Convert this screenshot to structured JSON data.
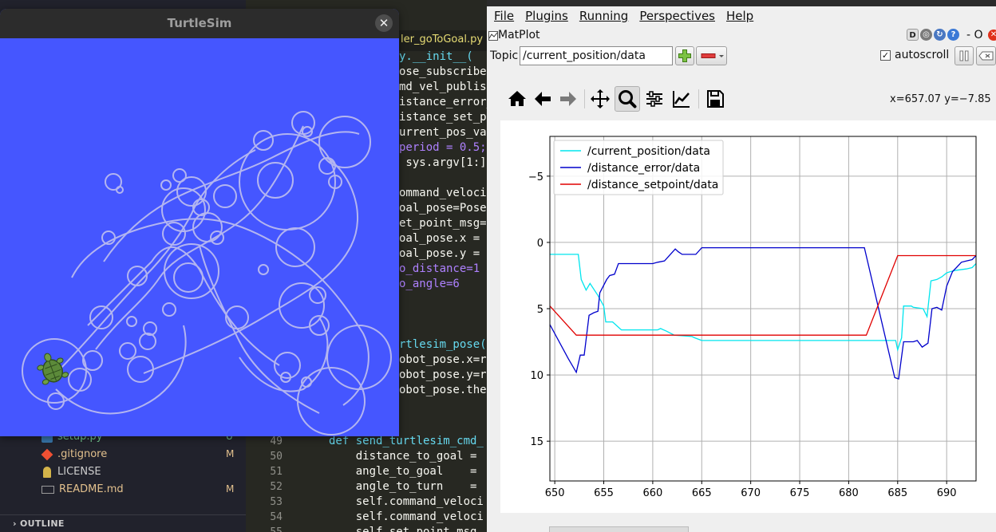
{
  "editor": {
    "tab_title": "ler_goToGoal.py",
    "code_lines": [
      {
        "t": "y.__init__(",
        "c": "fn"
      },
      {
        "t": "ose_subscribe",
        "c": ""
      },
      {
        "t": "md_vel_publis",
        "c": ""
      },
      {
        "t": "istance_error_",
        "c": ""
      },
      {
        "t": "istance_set_po",
        "c": ""
      },
      {
        "t": "urrent_pos_va",
        "c": ""
      },
      {
        "t": "period = 0.5;",
        "c": "num"
      },
      {
        "t": " sys.argv[1:]",
        "c": ""
      },
      {
        "t": "",
        "c": ""
      },
      {
        "t": "ommand_veloci",
        "c": ""
      },
      {
        "t": "oal_pose=Pose",
        "c": ""
      },
      {
        "t": "et_point_msg=",
        "c": ""
      },
      {
        "t": "oal_pose.x = ",
        "c": ""
      },
      {
        "t": "oal_pose.y = ",
        "c": ""
      },
      {
        "t": "o_distance=1",
        "c": "num"
      },
      {
        "t": "o_angle=6",
        "c": "num"
      },
      {
        "t": "",
        "c": ""
      },
      {
        "t": "",
        "c": ""
      },
      {
        "t": "",
        "c": ""
      },
      {
        "t": "rtlesim_pose(",
        "c": "fn"
      },
      {
        "t": "obot_pose.x=r",
        "c": ""
      },
      {
        "t": "obot_pose.y=r",
        "c": ""
      },
      {
        "t": "obot_pose.the",
        "c": ""
      }
    ],
    "lower_lines": [
      {
        "n": "49",
        "t": "def send_turtlesim_cmd_",
        "c": "kw"
      },
      {
        "n": "50",
        "t": "    distance_to_goal = ",
        "c": ""
      },
      {
        "n": "51",
        "t": "    angle_to_goal    = ",
        "c": ""
      },
      {
        "n": "52",
        "t": "    angle_to_turn    = ",
        "c": ""
      },
      {
        "n": "53",
        "t": "    self.command_veloci",
        "c": ""
      },
      {
        "n": "54",
        "t": "    self.command_veloci",
        "c": ""
      },
      {
        "n": "55",
        "t": "    self.set_point_msg.",
        "c": ""
      }
    ],
    "files": [
      {
        "name": "setup.py",
        "badge": "U"
      },
      {
        "name": ".gitignore",
        "badge": "M"
      },
      {
        "name": "LICENSE",
        "badge": ""
      },
      {
        "name": "README.md",
        "badge": "M"
      }
    ],
    "outline_label": "OUTLINE"
  },
  "turtlesim": {
    "title": "TurtleSim",
    "close_label": "✕",
    "background": "#4556ff",
    "trail_color": "#b3b5f0"
  },
  "rqt": {
    "menu": [
      "File",
      "Plugins",
      "Running",
      "Perspectives",
      "Help"
    ],
    "plugin_title": "MatPlot",
    "dock_d": "D",
    "dock_dash_o": "- O",
    "topic_label": "Topic",
    "topic_value": "/current_position/data",
    "autoscroll_label": "autoscroll",
    "autoscroll_checked": "✓",
    "coords_readout": "x=657.07 y=−7.85",
    "toolbar": [
      "home-icon",
      "back-icon",
      "forward-icon",
      "pan-icon",
      "zoom-icon",
      "configure-icon",
      "edit-curves-icon",
      "save-icon"
    ]
  },
  "chart_data": {
    "type": "line",
    "xlim": [
      649.5,
      693
    ],
    "ylim": [
      18,
      -8
    ],
    "y_inverted": true,
    "xticks": [
      650,
      655,
      660,
      665,
      670,
      675,
      680,
      685,
      690
    ],
    "yticks": [
      -5,
      0,
      5,
      10,
      15
    ],
    "ytick_labels": [
      "−5",
      "0",
      "5",
      "10",
      "15"
    ],
    "grid": true,
    "legend_placement": "top-left",
    "series": [
      {
        "name": "/current_position/data",
        "color": "#00e5ee",
        "points": [
          [
            649.5,
            0.9
          ],
          [
            652.4,
            0.9
          ],
          [
            652.7,
            2.8
          ],
          [
            653.2,
            3.6
          ],
          [
            653.6,
            3.1
          ],
          [
            654.4,
            4.0
          ],
          [
            655.0,
            4.8
          ],
          [
            655.2,
            6.0
          ],
          [
            655.9,
            6.0
          ],
          [
            656.8,
            6.6
          ],
          [
            660.5,
            6.6
          ],
          [
            660.8,
            6.5
          ],
          [
            661.4,
            6.7
          ],
          [
            662.2,
            7.0
          ],
          [
            664.0,
            7.1
          ],
          [
            664.3,
            7.2
          ],
          [
            665.0,
            7.4
          ],
          [
            682.0,
            7.4
          ],
          [
            684.8,
            7.4
          ],
          [
            685.0,
            8.1
          ],
          [
            685.4,
            7.2
          ],
          [
            685.6,
            4.8
          ],
          [
            686.4,
            4.8
          ],
          [
            686.6,
            4.9
          ],
          [
            687.6,
            5.0
          ],
          [
            688.0,
            5.6
          ],
          [
            688.4,
            2.9
          ],
          [
            689.0,
            2.8
          ],
          [
            689.5,
            2.6
          ],
          [
            690.0,
            2.3
          ],
          [
            690.4,
            2.2
          ],
          [
            691.0,
            2.1
          ],
          [
            692.0,
            2.0
          ],
          [
            692.6,
            1.9
          ],
          [
            693.0,
            1.6
          ]
        ]
      },
      {
        "name": "/distance_error/data",
        "color": "#0000cc",
        "points": [
          [
            649.5,
            6.2
          ],
          [
            651.4,
            8.8
          ],
          [
            652.2,
            9.8
          ],
          [
            652.6,
            8.5
          ],
          [
            653.0,
            8.5
          ],
          [
            653.5,
            5.5
          ],
          [
            654.0,
            5.3
          ],
          [
            654.4,
            5.2
          ],
          [
            654.6,
            3.8
          ],
          [
            655.3,
            2.8
          ],
          [
            655.6,
            2.5
          ],
          [
            656.1,
            2.4
          ],
          [
            656.5,
            1.6
          ],
          [
            660.0,
            1.6
          ],
          [
            660.5,
            1.5
          ],
          [
            661.2,
            1.4
          ],
          [
            661.8,
            0.9
          ],
          [
            662.3,
            0.5
          ],
          [
            662.6,
            0.7
          ],
          [
            663.0,
            0.9
          ],
          [
            664.4,
            0.9
          ],
          [
            665.0,
            0.4
          ],
          [
            681.6,
            0.4
          ],
          [
            684.7,
            10.2
          ],
          [
            685.1,
            10.3
          ],
          [
            685.6,
            7.5
          ],
          [
            686.6,
            7.5
          ],
          [
            687.0,
            7.4
          ],
          [
            687.5,
            7.9
          ],
          [
            688.1,
            7.6
          ],
          [
            688.5,
            5.0
          ],
          [
            689.0,
            4.9
          ],
          [
            689.5,
            5.1
          ],
          [
            690.0,
            3.3
          ],
          [
            690.6,
            2.2
          ],
          [
            691.0,
            1.9
          ],
          [
            691.5,
            1.5
          ],
          [
            692.0,
            1.4
          ],
          [
            692.6,
            1.3
          ],
          [
            693.0,
            1.0
          ]
        ]
      },
      {
        "name": "/distance_setpoint/data",
        "color": "#e00000",
        "points": [
          [
            649.5,
            4.8
          ],
          [
            652.2,
            7.0
          ],
          [
            681.8,
            7.0
          ],
          [
            685.0,
            1.0
          ],
          [
            693.0,
            1.0
          ]
        ]
      }
    ]
  }
}
